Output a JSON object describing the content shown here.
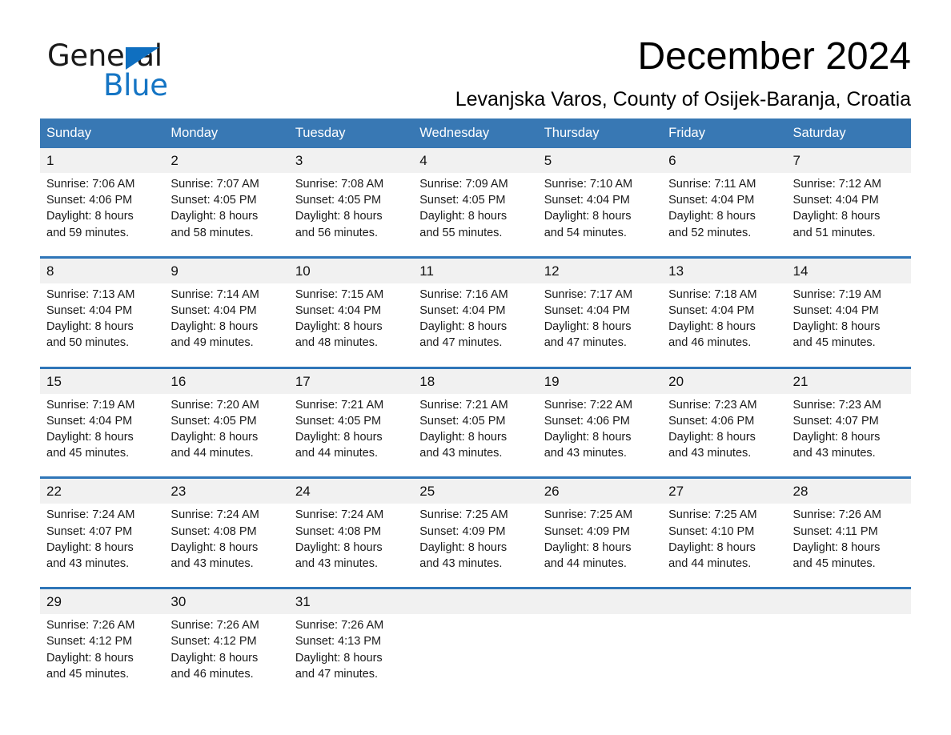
{
  "logo": {
    "word_primary": "General",
    "word_secondary": "Blue",
    "triangle_icon": "triangle-icon"
  },
  "header": {
    "title": "December 2024",
    "location": "Levanjska Varos, County of Osijek-Baranja, Croatia"
  },
  "colors": {
    "header_blue": "#3878b4",
    "row_rule_blue": "#2f76b8",
    "daynum_background": "#f1f1f1",
    "logo_blue": "#1575c4",
    "text": "#1a1a1a"
  },
  "calendar": {
    "weekday_headers": [
      "Sunday",
      "Monday",
      "Tuesday",
      "Wednesday",
      "Thursday",
      "Friday",
      "Saturday"
    ],
    "weeks": [
      {
        "days": [
          {
            "date": "1",
            "sunrise": "Sunrise: 7:06 AM",
            "sunset": "Sunset: 4:06 PM",
            "daylight_line1": "Daylight: 8 hours",
            "daylight_line2": "and 59 minutes."
          },
          {
            "date": "2",
            "sunrise": "Sunrise: 7:07 AM",
            "sunset": "Sunset: 4:05 PM",
            "daylight_line1": "Daylight: 8 hours",
            "daylight_line2": "and 58 minutes."
          },
          {
            "date": "3",
            "sunrise": "Sunrise: 7:08 AM",
            "sunset": "Sunset: 4:05 PM",
            "daylight_line1": "Daylight: 8 hours",
            "daylight_line2": "and 56 minutes."
          },
          {
            "date": "4",
            "sunrise": "Sunrise: 7:09 AM",
            "sunset": "Sunset: 4:05 PM",
            "daylight_line1": "Daylight: 8 hours",
            "daylight_line2": "and 55 minutes."
          },
          {
            "date": "5",
            "sunrise": "Sunrise: 7:10 AM",
            "sunset": "Sunset: 4:04 PM",
            "daylight_line1": "Daylight: 8 hours",
            "daylight_line2": "and 54 minutes."
          },
          {
            "date": "6",
            "sunrise": "Sunrise: 7:11 AM",
            "sunset": "Sunset: 4:04 PM",
            "daylight_line1": "Daylight: 8 hours",
            "daylight_line2": "and 52 minutes."
          },
          {
            "date": "7",
            "sunrise": "Sunrise: 7:12 AM",
            "sunset": "Sunset: 4:04 PM",
            "daylight_line1": "Daylight: 8 hours",
            "daylight_line2": "and 51 minutes."
          }
        ]
      },
      {
        "days": [
          {
            "date": "8",
            "sunrise": "Sunrise: 7:13 AM",
            "sunset": "Sunset: 4:04 PM",
            "daylight_line1": "Daylight: 8 hours",
            "daylight_line2": "and 50 minutes."
          },
          {
            "date": "9",
            "sunrise": "Sunrise: 7:14 AM",
            "sunset": "Sunset: 4:04 PM",
            "daylight_line1": "Daylight: 8 hours",
            "daylight_line2": "and 49 minutes."
          },
          {
            "date": "10",
            "sunrise": "Sunrise: 7:15 AM",
            "sunset": "Sunset: 4:04 PM",
            "daylight_line1": "Daylight: 8 hours",
            "daylight_line2": "and 48 minutes."
          },
          {
            "date": "11",
            "sunrise": "Sunrise: 7:16 AM",
            "sunset": "Sunset: 4:04 PM",
            "daylight_line1": "Daylight: 8 hours",
            "daylight_line2": "and 47 minutes."
          },
          {
            "date": "12",
            "sunrise": "Sunrise: 7:17 AM",
            "sunset": "Sunset: 4:04 PM",
            "daylight_line1": "Daylight: 8 hours",
            "daylight_line2": "and 47 minutes."
          },
          {
            "date": "13",
            "sunrise": "Sunrise: 7:18 AM",
            "sunset": "Sunset: 4:04 PM",
            "daylight_line1": "Daylight: 8 hours",
            "daylight_line2": "and 46 minutes."
          },
          {
            "date": "14",
            "sunrise": "Sunrise: 7:19 AM",
            "sunset": "Sunset: 4:04 PM",
            "daylight_line1": "Daylight: 8 hours",
            "daylight_line2": "and 45 minutes."
          }
        ]
      },
      {
        "days": [
          {
            "date": "15",
            "sunrise": "Sunrise: 7:19 AM",
            "sunset": "Sunset: 4:04 PM",
            "daylight_line1": "Daylight: 8 hours",
            "daylight_line2": "and 45 minutes."
          },
          {
            "date": "16",
            "sunrise": "Sunrise: 7:20 AM",
            "sunset": "Sunset: 4:05 PM",
            "daylight_line1": "Daylight: 8 hours",
            "daylight_line2": "and 44 minutes."
          },
          {
            "date": "17",
            "sunrise": "Sunrise: 7:21 AM",
            "sunset": "Sunset: 4:05 PM",
            "daylight_line1": "Daylight: 8 hours",
            "daylight_line2": "and 44 minutes."
          },
          {
            "date": "18",
            "sunrise": "Sunrise: 7:21 AM",
            "sunset": "Sunset: 4:05 PM",
            "daylight_line1": "Daylight: 8 hours",
            "daylight_line2": "and 43 minutes."
          },
          {
            "date": "19",
            "sunrise": "Sunrise: 7:22 AM",
            "sunset": "Sunset: 4:06 PM",
            "daylight_line1": "Daylight: 8 hours",
            "daylight_line2": "and 43 minutes."
          },
          {
            "date": "20",
            "sunrise": "Sunrise: 7:23 AM",
            "sunset": "Sunset: 4:06 PM",
            "daylight_line1": "Daylight: 8 hours",
            "daylight_line2": "and 43 minutes."
          },
          {
            "date": "21",
            "sunrise": "Sunrise: 7:23 AM",
            "sunset": "Sunset: 4:07 PM",
            "daylight_line1": "Daylight: 8 hours",
            "daylight_line2": "and 43 minutes."
          }
        ]
      },
      {
        "days": [
          {
            "date": "22",
            "sunrise": "Sunrise: 7:24 AM",
            "sunset": "Sunset: 4:07 PM",
            "daylight_line1": "Daylight: 8 hours",
            "daylight_line2": "and 43 minutes."
          },
          {
            "date": "23",
            "sunrise": "Sunrise: 7:24 AM",
            "sunset": "Sunset: 4:08 PM",
            "daylight_line1": "Daylight: 8 hours",
            "daylight_line2": "and 43 minutes."
          },
          {
            "date": "24",
            "sunrise": "Sunrise: 7:24 AM",
            "sunset": "Sunset: 4:08 PM",
            "daylight_line1": "Daylight: 8 hours",
            "daylight_line2": "and 43 minutes."
          },
          {
            "date": "25",
            "sunrise": "Sunrise: 7:25 AM",
            "sunset": "Sunset: 4:09 PM",
            "daylight_line1": "Daylight: 8 hours",
            "daylight_line2": "and 43 minutes."
          },
          {
            "date": "26",
            "sunrise": "Sunrise: 7:25 AM",
            "sunset": "Sunset: 4:09 PM",
            "daylight_line1": "Daylight: 8 hours",
            "daylight_line2": "and 44 minutes."
          },
          {
            "date": "27",
            "sunrise": "Sunrise: 7:25 AM",
            "sunset": "Sunset: 4:10 PM",
            "daylight_line1": "Daylight: 8 hours",
            "daylight_line2": "and 44 minutes."
          },
          {
            "date": "28",
            "sunrise": "Sunrise: 7:26 AM",
            "sunset": "Sunset: 4:11 PM",
            "daylight_line1": "Daylight: 8 hours",
            "daylight_line2": "and 45 minutes."
          }
        ]
      },
      {
        "days": [
          {
            "date": "29",
            "sunrise": "Sunrise: 7:26 AM",
            "sunset": "Sunset: 4:12 PM",
            "daylight_line1": "Daylight: 8 hours",
            "daylight_line2": "and 45 minutes."
          },
          {
            "date": "30",
            "sunrise": "Sunrise: 7:26 AM",
            "sunset": "Sunset: 4:12 PM",
            "daylight_line1": "Daylight: 8 hours",
            "daylight_line2": "and 46 minutes."
          },
          {
            "date": "31",
            "sunrise": "Sunrise: 7:26 AM",
            "sunset": "Sunset: 4:13 PM",
            "daylight_line1": "Daylight: 8 hours",
            "daylight_line2": "and 47 minutes."
          },
          {
            "date": "",
            "sunrise": "",
            "sunset": "",
            "daylight_line1": "",
            "daylight_line2": ""
          },
          {
            "date": "",
            "sunrise": "",
            "sunset": "",
            "daylight_line1": "",
            "daylight_line2": ""
          },
          {
            "date": "",
            "sunrise": "",
            "sunset": "",
            "daylight_line1": "",
            "daylight_line2": ""
          },
          {
            "date": "",
            "sunrise": "",
            "sunset": "",
            "daylight_line1": "",
            "daylight_line2": ""
          }
        ]
      }
    ]
  }
}
